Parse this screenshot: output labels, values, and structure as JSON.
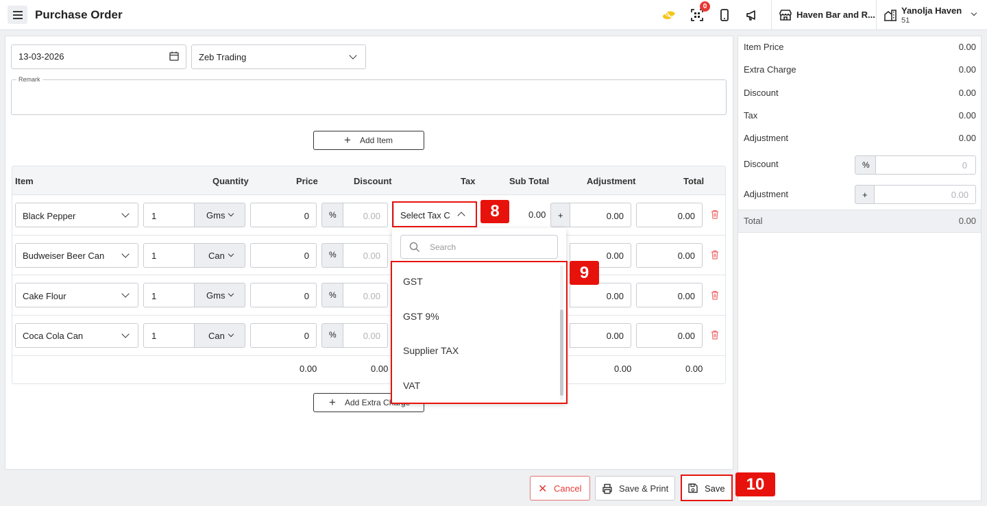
{
  "header": {
    "title": "Purchase Order",
    "notification_count": "0",
    "store_name": "Haven Bar and R...",
    "company_name": "Yanolja Haven",
    "company_id": "51",
    "icons": [
      "menu-icon",
      "coins-icon",
      "scanner-icon",
      "mobile-icon",
      "megaphone-icon",
      "store-icon",
      "building-icon",
      "chevron-down-icon"
    ]
  },
  "form": {
    "date": "13-03-2026",
    "supplier": "Zeb Trading",
    "remark_label": "Remark",
    "remark_value": "",
    "add_item_label": "Add Item",
    "add_extra_charge_label": "Add Extra Charge"
  },
  "table": {
    "columns": [
      "Item",
      "Quantity",
      "Price",
      "Discount",
      "Tax",
      "Sub Total",
      "Adjustment",
      "Total"
    ],
    "rows": [
      {
        "item": "Black Pepper",
        "qty": "1",
        "unit": "Gms",
        "price": "0",
        "disc_type": "%",
        "discount": "0.00",
        "tax": "Select Tax C",
        "subtotal": "0.00",
        "adj_sign": "+",
        "adjustment": "0.00",
        "total": "0.00"
      },
      {
        "item": "Budweiser Beer Can",
        "qty": "1",
        "unit": "Can",
        "price": "0",
        "disc_type": "%",
        "discount": "0.00",
        "adjustment": "0.00",
        "total": "0.00"
      },
      {
        "item": "Cake Flour",
        "qty": "1",
        "unit": "Gms",
        "price": "0",
        "disc_type": "%",
        "discount": "0.00",
        "adjustment": "0.00",
        "total": "0.00"
      },
      {
        "item": "Coca Cola Can",
        "qty": "1",
        "unit": "Can",
        "price": "0",
        "disc_type": "%",
        "discount": "0.00",
        "adjustment": "0.00",
        "total": "0.00"
      }
    ],
    "footer": {
      "price": "0.00",
      "discount": "0.00",
      "adjustment": "0.00",
      "total": "0.00"
    }
  },
  "tax_dropdown": {
    "search_placeholder": "Search",
    "options": [
      "GST",
      "GST 9%",
      "Supplier TAX",
      "VAT"
    ]
  },
  "summary": {
    "item_price_label": "Item Price",
    "item_price": "0.00",
    "extra_charge_label": "Extra Charge",
    "extra_charge": "0.00",
    "discount_label": "Discount",
    "discount": "0.00",
    "tax_label": "Tax",
    "tax": "0.00",
    "adjustment_label": "Adjustment",
    "adjustment": "0.00",
    "discount_input_label": "Discount",
    "discount_type": "%",
    "discount_input": "0",
    "adjustment_input_label": "Adjustment",
    "adjustment_sign": "+",
    "adjustment_input": "0.00",
    "total_label": "Total",
    "total": "0.00"
  },
  "actions": {
    "cancel_label": "Cancel",
    "save_print_label": "Save & Print",
    "save_label": "Save"
  },
  "annotations": {
    "step8": "8",
    "step9": "9",
    "step10": "10"
  },
  "colors": {
    "accent_red": "#e8120c",
    "cancel_red": "#e53935",
    "trash_red": "#ef6b6b",
    "coin_yellow": "#f5c518"
  }
}
